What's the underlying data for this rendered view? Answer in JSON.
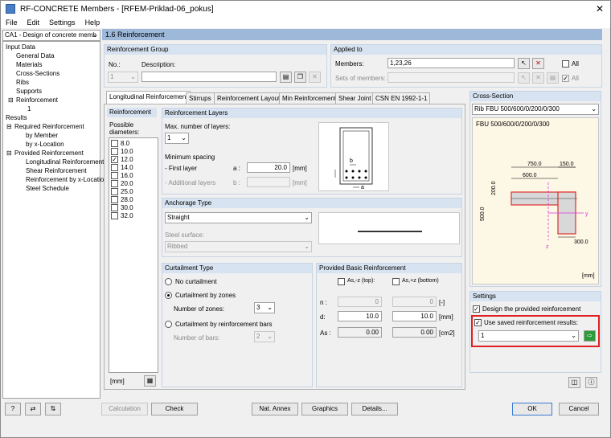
{
  "window": {
    "title": "RF-CONCRETE Members - [RFEM-Priklad-06_pokus]",
    "close": "✕"
  },
  "menu": [
    "File",
    "Edit",
    "Settings",
    "Help"
  ],
  "case_select": "CA1 - Design of concrete memb",
  "tree": {
    "input_data": "Input Data",
    "general_data": "General Data",
    "materials": "Materials",
    "cross_sections": "Cross-Sections",
    "ribs": "Ribs",
    "supports": "Supports",
    "reinforcement": "Reinforcement",
    "reinf_1": "1",
    "results": "Results",
    "required_reinforcement": "Required Reinforcement",
    "by_member": "by Member",
    "by_x_location": "by x-Location",
    "provided_reinforcement": "Provided Reinforcement",
    "longitudinal_reinforcement": "Longitudinal Reinforcement",
    "shear_reinforcement": "Shear Reinforcement",
    "reinforcement_by_x": "Reinforcement by x-Location",
    "steel_schedule": "Steel Schedule"
  },
  "section_header": "1.6 Reinforcement",
  "reinf_group": {
    "title": "Reinforcement Group",
    "no_label": "No.:",
    "desc_label": "Description:",
    "no_value": "1",
    "desc_value": ""
  },
  "applied": {
    "title": "Applied to",
    "members_label": "Members:",
    "members_value": "1,23,26",
    "sets_label": "Sets of members:",
    "sets_value": "",
    "all": "All"
  },
  "tabs": [
    "Longitudinal Reinforcement",
    "Stirrups",
    "Reinforcement Layout",
    "Min Reinforcement",
    "Shear Joint",
    "CSN EN 1992-1-1"
  ],
  "reinforcement_panel": {
    "title": "Reinforcement",
    "possible": "Possible",
    "diameters": "diameters:",
    "unit": "[mm]",
    "items": [
      {
        "v": "8.0",
        "c": false
      },
      {
        "v": "10.0",
        "c": false
      },
      {
        "v": "12.0",
        "c": true
      },
      {
        "v": "14.0",
        "c": false
      },
      {
        "v": "16.0",
        "c": false
      },
      {
        "v": "20.0",
        "c": false
      },
      {
        "v": "25.0",
        "c": false
      },
      {
        "v": "28.0",
        "c": false
      },
      {
        "v": "30.0",
        "c": false
      },
      {
        "v": "32.0",
        "c": false
      }
    ]
  },
  "layers": {
    "title": "Reinforcement Layers",
    "max_layers": "Max. number of layers:",
    "max_value": "1",
    "min_spacing": "Minimum spacing",
    "first_layer": "- First layer",
    "first_var": "a :",
    "first_value": "20.0",
    "additional": "- Additional layers",
    "add_var": "b :",
    "add_value": "",
    "unit": "[mm]",
    "img_b": "b",
    "img_a": "a"
  },
  "anchorage": {
    "title": "Anchorage Type",
    "type": "Straight",
    "steel_surface": "Steel surface:",
    "surface_value": "Ribbed"
  },
  "curtailment": {
    "title": "Curtailment Type",
    "no": "No curtailment",
    "zones": "Curtailment by zones",
    "num_zones": "Number of zones:",
    "zones_value": "3",
    "bars": "Curtailment by reinforcement bars",
    "num_bars": "Number of bars:",
    "bars_value": "2"
  },
  "provided": {
    "title": "Provided Basic Reinforcement",
    "top": "As,-z (top):",
    "bottom": "As,+z (bottom)",
    "n_label": "n :",
    "n_top": "0",
    "n_bot": "0",
    "n_unit": "[-]",
    "d_label": "d:",
    "d_top": "10.0",
    "d_bot": "10.0",
    "d_unit": "[mm]",
    "as_label": "As :",
    "as_top": "0.00",
    "as_bot": "0.00",
    "as_unit": "[cm2]"
  },
  "cross_section": {
    "title": "Cross-Section",
    "select": "Rib FBU 500/600/0/200/0/300",
    "name": "FBU 500/600/0/200/0/300",
    "dim_750": "750.0",
    "dim_150": "150.0",
    "dim_600": "600.0",
    "dim_200": "200.0",
    "dim_500": "500.0",
    "dim_300": "300.0",
    "axis_y": "y",
    "axis_z": "z",
    "unit": "[mm]"
  },
  "settings": {
    "title": "Settings",
    "design_provided": "Design the provided reinforcement",
    "use_saved": "Use saved reinforcement results:",
    "saved_value": "1"
  },
  "buttons": {
    "calculation": "Calculation",
    "check": "Check",
    "nat_annex": "Nat. Annex",
    "graphics": "Graphics",
    "details": "Details...",
    "ok": "OK",
    "cancel": "Cancel"
  },
  "colors": {
    "header": "#9db8d8",
    "panel_head": "#d7e3f1",
    "highlight": "#e02020",
    "section_red": "#e03030",
    "magenta": "#e030e0"
  }
}
